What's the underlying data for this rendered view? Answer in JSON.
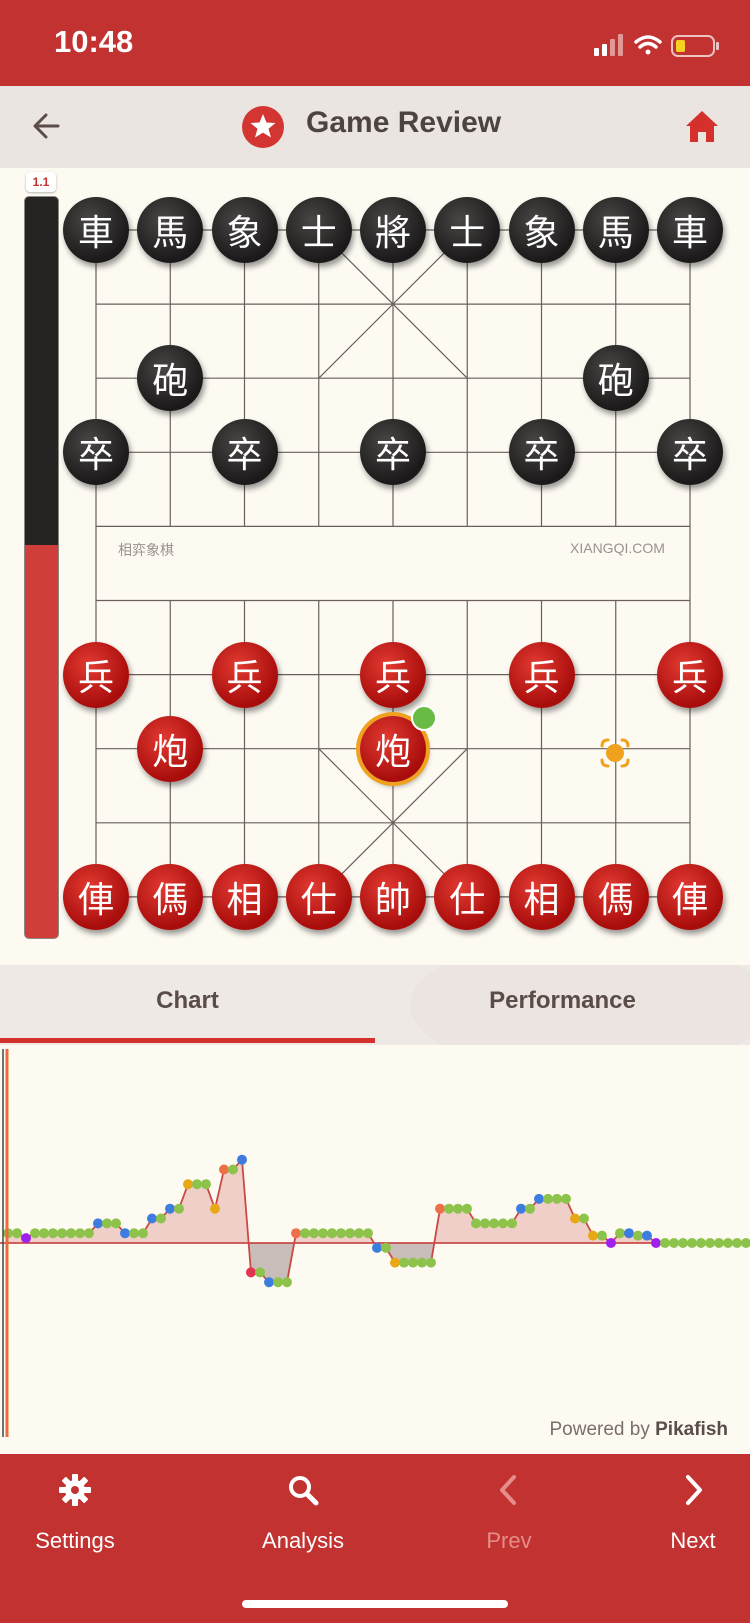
{
  "status_bar": {
    "time": "10:48"
  },
  "header": {
    "title": "Game Review"
  },
  "eval_bar": {
    "label": "1.1",
    "black_fraction": 0.47
  },
  "board": {
    "river_left": "相弈象棋",
    "river_right": "XIANGQI.COM",
    "pieces": [
      {
        "side": "black",
        "char": "車",
        "file": 0,
        "rank": 0
      },
      {
        "side": "black",
        "char": "馬",
        "file": 1,
        "rank": 0
      },
      {
        "side": "black",
        "char": "象",
        "file": 2,
        "rank": 0
      },
      {
        "side": "black",
        "char": "士",
        "file": 3,
        "rank": 0
      },
      {
        "side": "black",
        "char": "將",
        "file": 4,
        "rank": 0
      },
      {
        "side": "black",
        "char": "士",
        "file": 5,
        "rank": 0
      },
      {
        "side": "black",
        "char": "象",
        "file": 6,
        "rank": 0
      },
      {
        "side": "black",
        "char": "馬",
        "file": 7,
        "rank": 0
      },
      {
        "side": "black",
        "char": "車",
        "file": 8,
        "rank": 0
      },
      {
        "side": "black",
        "char": "砲",
        "file": 1,
        "rank": 2
      },
      {
        "side": "black",
        "char": "砲",
        "file": 7,
        "rank": 2
      },
      {
        "side": "black",
        "char": "卒",
        "file": 0,
        "rank": 3
      },
      {
        "side": "black",
        "char": "卒",
        "file": 2,
        "rank": 3
      },
      {
        "side": "black",
        "char": "卒",
        "file": 4,
        "rank": 3
      },
      {
        "side": "black",
        "char": "卒",
        "file": 6,
        "rank": 3
      },
      {
        "side": "black",
        "char": "卒",
        "file": 8,
        "rank": 3
      },
      {
        "side": "red",
        "char": "兵",
        "file": 0,
        "rank": 6
      },
      {
        "side": "red",
        "char": "兵",
        "file": 2,
        "rank": 6
      },
      {
        "side": "red",
        "char": "兵",
        "file": 4,
        "rank": 6
      },
      {
        "side": "red",
        "char": "兵",
        "file": 6,
        "rank": 6
      },
      {
        "side": "red",
        "char": "兵",
        "file": 8,
        "rank": 6
      },
      {
        "side": "red",
        "char": "炮",
        "file": 1,
        "rank": 7
      },
      {
        "side": "red",
        "char": "炮",
        "file": 4,
        "rank": 7,
        "selected": true
      },
      {
        "side": "red",
        "char": "俥",
        "file": 0,
        "rank": 9
      },
      {
        "side": "red",
        "char": "傌",
        "file": 1,
        "rank": 9
      },
      {
        "side": "red",
        "char": "相",
        "file": 2,
        "rank": 9
      },
      {
        "side": "red",
        "char": "仕",
        "file": 3,
        "rank": 9
      },
      {
        "side": "red",
        "char": "帥",
        "file": 4,
        "rank": 9
      },
      {
        "side": "red",
        "char": "仕",
        "file": 5,
        "rank": 9
      },
      {
        "side": "red",
        "char": "相",
        "file": 6,
        "rank": 9
      },
      {
        "side": "red",
        "char": "傌",
        "file": 7,
        "rank": 9
      },
      {
        "side": "red",
        "char": "俥",
        "file": 8,
        "rank": 9
      }
    ],
    "move_target": {
      "file": 7,
      "rank": 7,
      "icon": "move-target-icon"
    }
  },
  "tabs": [
    {
      "label": "Chart",
      "active": true
    },
    {
      "label": "Performance",
      "active": false
    }
  ],
  "chart_data": {
    "type": "line",
    "ylim": [
      -3,
      5
    ],
    "x": [
      0,
      1,
      2,
      3,
      4,
      5,
      6,
      7,
      8,
      9,
      10,
      11,
      12,
      13,
      14,
      15,
      16,
      17,
      18,
      19,
      20,
      21,
      22,
      23,
      24,
      25,
      26,
      27,
      28,
      29,
      30,
      31,
      32,
      33,
      34,
      35,
      36,
      37,
      38,
      39,
      40,
      41,
      42,
      43,
      44,
      45,
      46,
      47,
      48,
      49,
      50,
      51,
      52,
      53,
      54,
      55,
      56,
      57,
      58,
      59,
      60,
      61,
      62,
      63,
      64,
      65,
      66,
      67,
      68,
      69,
      70,
      71,
      72,
      73,
      74,
      75,
      76,
      77,
      78,
      79,
      80,
      81,
      82
    ],
    "values": [
      0.2,
      0.2,
      0.1,
      0.2,
      0.2,
      0.2,
      0.2,
      0.2,
      0.2,
      0.2,
      0.4,
      0.4,
      0.4,
      0.2,
      0.2,
      0.2,
      0.5,
      0.5,
      0.7,
      0.7,
      1.2,
      1.2,
      1.2,
      0.7,
      1.5,
      1.5,
      1.7,
      -0.6,
      -0.6,
      -0.8,
      -0.8,
      -0.8,
      0.2,
      0.2,
      0.2,
      0.2,
      0.2,
      0.2,
      0.2,
      0.2,
      0.2,
      -0.1,
      -0.1,
      -0.4,
      -0.4,
      -0.4,
      -0.4,
      -0.4,
      0.7,
      0.7,
      0.7,
      0.7,
      0.4,
      0.4,
      0.4,
      0.4,
      0.4,
      0.7,
      0.7,
      0.9,
      0.9,
      0.9,
      0.9,
      0.5,
      0.5,
      0.15,
      0.15,
      0.0,
      0.2,
      0.2,
      0.15,
      0.15,
      0.0,
      0.0,
      0.0,
      0.0,
      0.0,
      0.0,
      0.0,
      0.0,
      0.0,
      0.0,
      0.0
    ],
    "point_colors": [
      "#8dc34a",
      "#8dc34a",
      "#a020f0",
      "#8dc34a",
      "#8dc34a",
      "#8dc34a",
      "#8dc34a",
      "#8dc34a",
      "#8dc34a",
      "#8dc34a",
      "#3d7de0",
      "#8dc34a",
      "#8dc34a",
      "#3d7de0",
      "#8dc34a",
      "#8dc34a",
      "#3d7de0",
      "#8dc34a",
      "#3d7de0",
      "#8dc34a",
      "#e6a817",
      "#8dc34a",
      "#8dc34a",
      "#e6a817",
      "#ed7048",
      "#8dc34a",
      "#3d7de0",
      "#e0344f",
      "#8dc34a",
      "#3d7de0",
      "#8dc34a",
      "#8dc34a",
      "#ed7048",
      "#8dc34a",
      "#8dc34a",
      "#8dc34a",
      "#8dc34a",
      "#8dc34a",
      "#8dc34a",
      "#8dc34a",
      "#8dc34a",
      "#3d7de0",
      "#8dc34a",
      "#e6a817",
      "#8dc34a",
      "#8dc34a",
      "#8dc34a",
      "#8dc34a",
      "#ed7048",
      "#8dc34a",
      "#8dc34a",
      "#8dc34a",
      "#8dc34a",
      "#8dc34a",
      "#8dc34a",
      "#8dc34a",
      "#8dc34a",
      "#3d7de0",
      "#8dc34a",
      "#3d7de0",
      "#8dc34a",
      "#8dc34a",
      "#8dc34a",
      "#e6a817",
      "#8dc34a",
      "#e6a817",
      "#8dc34a",
      "#a020f0",
      "#8dc34a",
      "#3d7de0",
      "#8dc34a",
      "#3d7de0",
      "#a020f0",
      "#8dc34a",
      "#8dc34a",
      "#8dc34a",
      "#8dc34a",
      "#8dc34a",
      "#8dc34a",
      "#8dc34a",
      "#8dc34a",
      "#8dc34a",
      "#8dc34a"
    ],
    "current_move_index": 0,
    "powered_by_prefix": "Powered by",
    "powered_by_brand": "Pikafish"
  },
  "bottom_nav": [
    {
      "label": "Settings",
      "icon": "gear-icon",
      "enabled": true
    },
    {
      "label": "Analysis",
      "icon": "search-icon",
      "enabled": true
    },
    {
      "label": "Prev",
      "icon": "chevron-left-icon",
      "enabled": false
    },
    {
      "label": "Next",
      "icon": "chevron-right-icon",
      "enabled": true
    }
  ]
}
